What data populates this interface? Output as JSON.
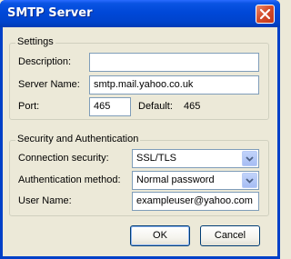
{
  "window": {
    "title": "SMTP Server"
  },
  "settings": {
    "legend": "Settings",
    "description_label": "Description:",
    "description_value": "",
    "server_name_label": "Server Name:",
    "server_name_value": "smtp.mail.yahoo.co.uk",
    "port_label": "Port:",
    "port_value": "465",
    "default_label": "Default:",
    "default_value": "465"
  },
  "security": {
    "legend": "Security and Authentication",
    "connection_security_label": "Connection security:",
    "connection_security_value": "SSL/TLS",
    "auth_method_label": "Authentication method:",
    "auth_method_value": "Normal password",
    "username_label": "User Name:",
    "username_value": "exampleuser@yahoo.com"
  },
  "buttons": {
    "ok": "OK",
    "cancel": "Cancel"
  },
  "icons": {
    "close": "close-icon",
    "dropdown": "chevron-down-icon"
  },
  "colors": {
    "titlebar": "#0048d8",
    "dialog_bg": "#ece9d8",
    "close_button": "#d54d2c"
  }
}
